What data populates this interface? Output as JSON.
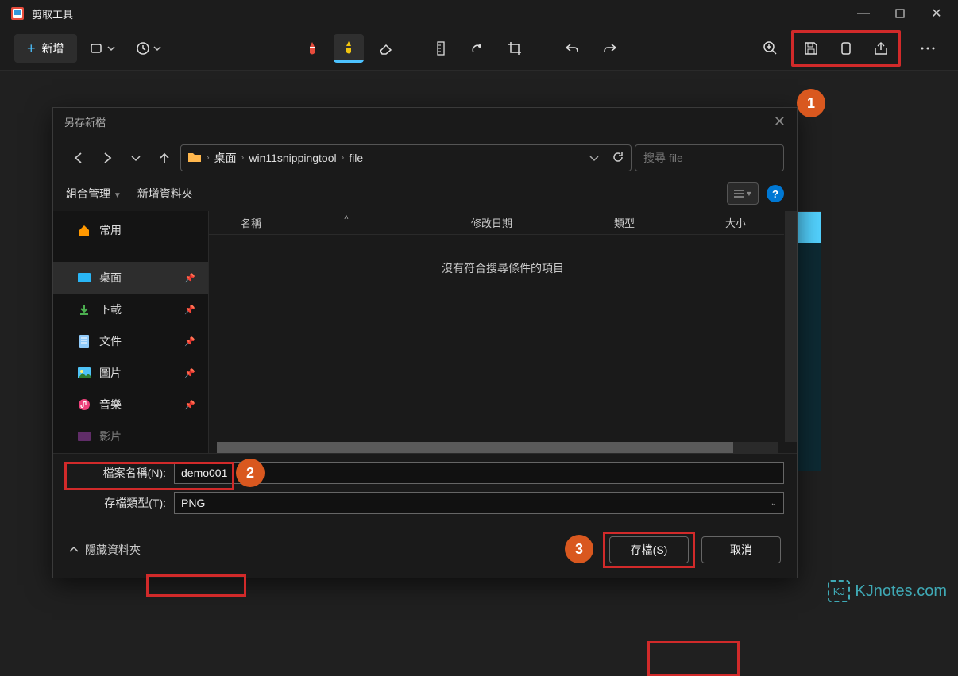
{
  "app": {
    "title": "剪取工具"
  },
  "window_controls": {
    "min": "—",
    "max": "▢",
    "close": "✕"
  },
  "toolbar": {
    "new_label": "新增",
    "plus": "+"
  },
  "annotations": {
    "a1": "1",
    "a2": "2",
    "a3": "3"
  },
  "dialog": {
    "title": "另存新檔",
    "breadcrumb": {
      "seg1": "桌面",
      "seg2": "win11snippingtool",
      "seg3": "file"
    },
    "search_placeholder": "搜尋 file",
    "toolbar": {
      "organize": "組合管理",
      "new_folder": "新增資料夾"
    },
    "sidebar": {
      "home": "常用",
      "desktop": "桌面",
      "downloads": "下載",
      "documents": "文件",
      "pictures": "圖片",
      "music": "音樂",
      "videos": "影片"
    },
    "columns": {
      "name": "名稱",
      "date": "修改日期",
      "type": "類型",
      "size": "大小"
    },
    "empty": "沒有符合搜尋條件的項目",
    "filename_label": "檔案名稱(N):",
    "filename_value": "demo001",
    "filetype_label": "存檔類型(T):",
    "filetype_value": "PNG",
    "hidden_folders": "隱藏資料夾",
    "save": "存檔(S)",
    "cancel": "取消"
  },
  "watermark": "KJnotes.com"
}
